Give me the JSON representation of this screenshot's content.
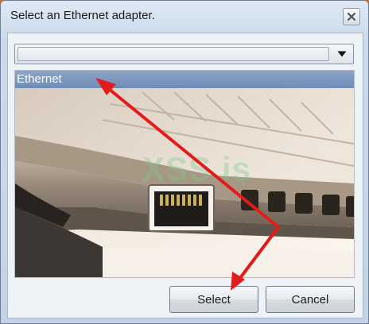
{
  "dialog": {
    "title": "Select an Ethernet adapter."
  },
  "adapter_dropdown": {
    "selected_value": ""
  },
  "adapter_list": {
    "items": [
      {
        "label": "Ethernet",
        "selected": true
      }
    ]
  },
  "watermark": "XSS.is",
  "buttons": {
    "select_label": "Select",
    "cancel_label": "Cancel"
  },
  "icons": {
    "close": "close-icon",
    "dropdown": "chevron-down-icon"
  },
  "colors": {
    "title_bar": "#cbdbec",
    "selection": "#7f98bf",
    "annotation_arrow": "#e31b1b",
    "desktop": "#d9691f"
  }
}
